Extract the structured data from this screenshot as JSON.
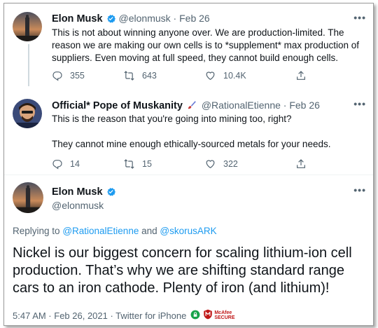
{
  "tweets": [
    {
      "name": "Elon Musk",
      "handle": "@elonmusk",
      "date": "Feb 26",
      "text": "This is not about winning anyone over. We are production-limited. The reason we are making our own cells is to *supplement* max production of suppliers. Even moving at full speed, they cannot build enough cells.",
      "replies": "355",
      "retweets": "643",
      "likes": "10.4K"
    },
    {
      "name": "Official* Pope of Muskanity",
      "handle": "@RationalEtienne",
      "date": "Feb 26",
      "text_line1": "This is the reason that you're going into mining too, right?",
      "text_line2": "They cannot mine enough ethically-sourced metals for your needs.",
      "replies": "14",
      "retweets": "15",
      "likes": "322"
    }
  ],
  "main_tweet": {
    "name": "Elon Musk",
    "handle": "@elonmusk",
    "replying_prefix": "Replying to",
    "mention1": "@RationalEtienne",
    "and_word": "and",
    "mention2": "@skorusARK",
    "text": "Nickel is our biggest concern for scaling lithium-ion cell production. That’s why we are shifting standard range cars to an iron cathode. Plenty of iron (and lithium)!",
    "timestamp": "5:47 AM · Feb 26, 2021 · Twitter for iPhone",
    "badge_text1": "McAfee",
    "badge_text2": "SECURE"
  },
  "more_label": "•••",
  "colors": {
    "accent": "#1d9bf0",
    "muted": "#536471",
    "verified": "#1d9bf0",
    "mcafee": "#c01818"
  },
  "icons": [
    "reply-icon",
    "retweet-icon",
    "like-icon",
    "share-icon",
    "verified-badge-icon",
    "brush-emoji-icon",
    "mcafee-shield-icon",
    "lock-icon"
  ]
}
